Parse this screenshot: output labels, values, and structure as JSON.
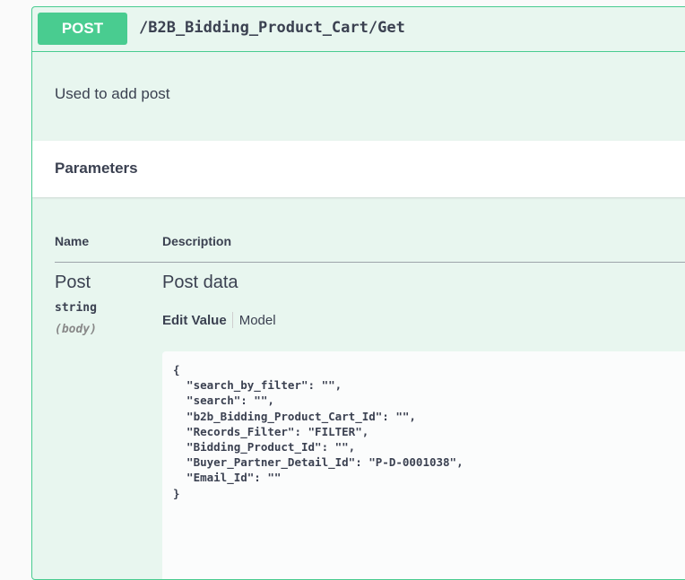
{
  "operation": {
    "method": "POST",
    "path": "/B2B_Bidding_Product_Cart/Get",
    "description": "Used to add post"
  },
  "parameters": {
    "title": "Parameters",
    "columns": {
      "name": "Name",
      "description": "Description"
    },
    "items": [
      {
        "name": "Post",
        "type": "string",
        "in": "(body)",
        "description": "Post data",
        "tabs": {
          "edit_value": "Edit Value",
          "model": "Model"
        },
        "body_value": "{\n  \"search_by_filter\": \"\",\n  \"search\": \"\",\n  \"b2b_Bidding_Product_Cart_Id\": \"\",\n  \"Records_Filter\": \"FILTER\",\n  \"Bidding_Product_Id\": \"\",\n  \"Buyer_Partner_Detail_Id\": \"P-D-0001038\",\n  \"Email_Id\": \"\"\n}"
      }
    ]
  },
  "colors": {
    "method_post": "#49cc90",
    "block_background": "#e8f6ef",
    "text": "#3b4151"
  }
}
